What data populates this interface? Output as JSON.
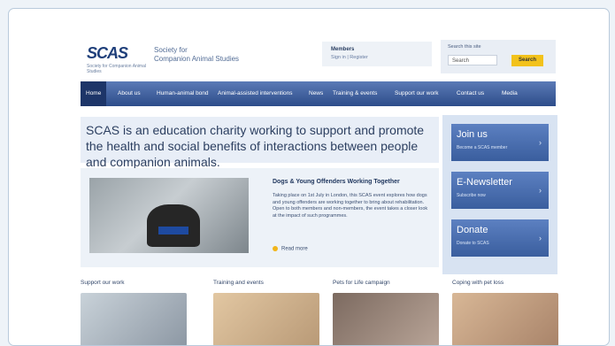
{
  "site": {
    "logo_text": "SCAS",
    "logo_sub": "Society for Companion Animal Studies",
    "society_lines": [
      "Society for",
      "Companion Animal Studies"
    ]
  },
  "members": {
    "title": "Members",
    "links": "Sign in  |  Register"
  },
  "search": {
    "label": "Search this site",
    "placeholder": "Search",
    "button": "Search"
  },
  "nav": [
    "Home",
    "About us",
    "Human-animal bond",
    "Animal-assisted interventions",
    "News",
    "Training & events",
    "Support our work",
    "Contact us",
    "Media"
  ],
  "intro": "SCAS is an education charity working to support and promote the health and social benefits of interactions between people and companion animals.",
  "feature": {
    "title": "Dogs & Young Offenders Working Together",
    "body": "Taking place on 1st July in London, this SCAS event explores how dogs and young offenders are working together to bring about rehabilitation. Open to both members and non-members, the event takes a closer look at the impact of such programmes.",
    "read_more": "Read more"
  },
  "sidebar": [
    {
      "title": "Join us",
      "sub": "Become a SCAS member"
    },
    {
      "title": "E-Newsletter",
      "sub": "Subscribe now"
    },
    {
      "title": "Donate",
      "sub": "Donate to SCAS"
    }
  ],
  "columns": [
    {
      "heading": "Support our work"
    },
    {
      "heading": "Training and events"
    },
    {
      "heading": "Pets for Life campaign"
    },
    {
      "heading": "Coping with pet loss"
    }
  ],
  "colors": {
    "nav_blue": "#2d4d8a",
    "accent_yellow": "#f2c21b",
    "panel_blue": "#3a5e9e"
  }
}
